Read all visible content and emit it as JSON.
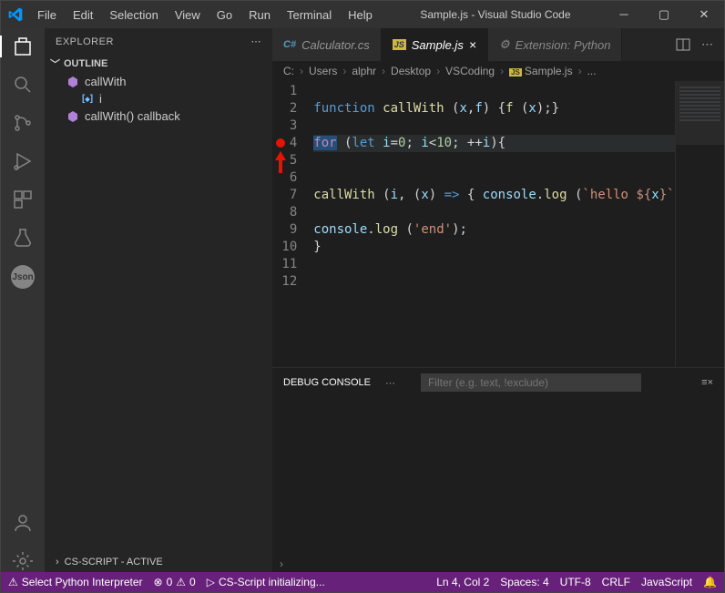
{
  "title": "Sample.js - Visual Studio Code",
  "menu": [
    "File",
    "Edit",
    "Selection",
    "View",
    "Go",
    "Run",
    "Terminal",
    "Help"
  ],
  "sidebar": {
    "title": "EXPLORER",
    "outline_label": "OUTLINE",
    "items": [
      {
        "icon": "cube",
        "label": "callWith",
        "type": "method"
      },
      {
        "icon": "bracket",
        "label": "i",
        "type": "var"
      },
      {
        "icon": "cube",
        "label": "callWith() callback",
        "type": "method"
      }
    ]
  },
  "tabs": [
    {
      "icon": "cs",
      "label": "Calculator.cs",
      "active": false
    },
    {
      "icon": "js",
      "label": "Sample.js",
      "active": true,
      "closeable": true
    },
    {
      "icon": "ext",
      "label": "Extension: Python",
      "ghost": true
    }
  ],
  "breadcrumbs": [
    "C:",
    "Users",
    "alphr",
    "Desktop",
    "VSCoding",
    "JS Sample.js",
    "..."
  ],
  "code": {
    "lines": [
      {
        "n": 1,
        "html": ""
      },
      {
        "n": 2,
        "html": "<span class='fn'>function</span> <span class='id'>callWith</span> <span class='pl'>(</span><span class='pr'>x</span><span class='pl'>,</span><span class='pr'>f</span><span class='pl'>) {</span><span class='id'>f</span> <span class='pl'>(</span><span class='pr'>x</span><span class='pl'>);}</span>"
      },
      {
        "n": 3,
        "html": ""
      },
      {
        "n": 4,
        "bp": true,
        "hl": true,
        "html": "<span class='sel kw'>for</span><span class='pl'> (</span><span class='fn'>let</span> <span class='pr'>i</span><span class='pl'>=</span><span class='num'>0</span><span class='pl'>; </span><span class='pr'>i</span><span class='pl'>&lt;</span><span class='num'>10</span><span class='pl'>; ++</span><span class='pr'>i</span><span class='pl'>){</span>"
      },
      {
        "n": 5,
        "html": ""
      },
      {
        "n": 6,
        "html": ""
      },
      {
        "n": 7,
        "html": "<span class='id'>callWith</span> <span class='pl'>(</span><span class='pr'>i</span><span class='pl'>, (</span><span class='pr'>x</span><span class='pl'>) </span><span class='fn'>=&gt;</span><span class='pl'> { </span><span class='pr'>console</span><span class='pl'>.</span><span class='id'>log</span> <span class='pl'>(</span><span class='str'>`hello ${</span><span class='pr'>x</span><span class='str'>}`</span>"
      },
      {
        "n": 8,
        "html": ""
      },
      {
        "n": 9,
        "html": "<span class='pr'>console</span><span class='pl'>.</span><span class='id'>log</span> <span class='pl'>(</span><span class='str'>'end'</span><span class='pl'>);</span>"
      },
      {
        "n": 10,
        "html": "<span class='pl'>}</span>"
      },
      {
        "n": 11,
        "html": ""
      },
      {
        "n": 12,
        "html": ""
      }
    ]
  },
  "panel": {
    "tab": "DEBUG CONSOLE",
    "filter_placeholder": "Filter (e.g. text, !exclude)"
  },
  "collapsed_section": "CS-SCRIPT - ACTIVE",
  "status": {
    "left": [
      {
        "icon": "warning",
        "label": "Select Python Interpreter"
      },
      {
        "icon": "errwarn",
        "label": "0  0"
      },
      {
        "icon": "play",
        "label": "CS-Script initializing..."
      }
    ],
    "right": [
      "Ln 4, Col 2",
      "Spaces: 4",
      "UTF-8",
      "CRLF",
      "JavaScript"
    ]
  }
}
